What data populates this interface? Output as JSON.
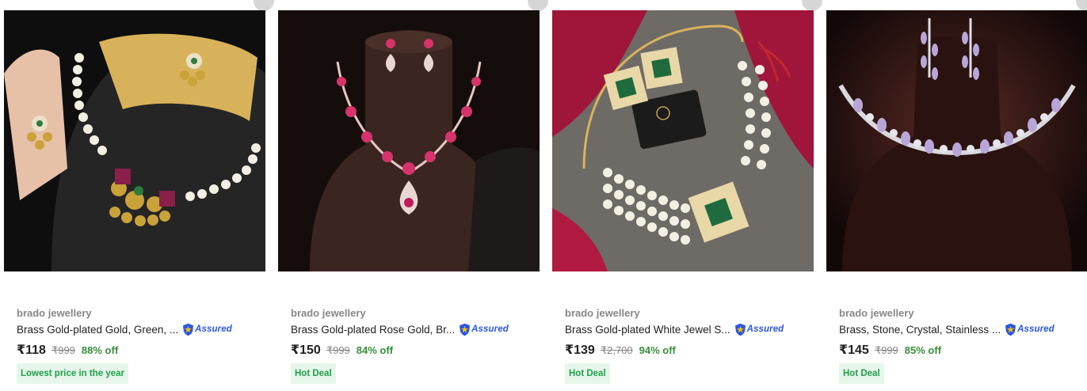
{
  "products": [
    {
      "brand": "brado jewellery",
      "title": "Brass Gold-plated Gold, Green, ...",
      "assured_label": "Assured",
      "price": "₹118",
      "mrp": "₹999",
      "discount": "88% off",
      "badge": "Lowest price in the year",
      "image": "gold-pearl-necklace-set"
    },
    {
      "brand": "brado jewellery",
      "title": "Brass Gold-plated Rose Gold, Br...",
      "assured_label": "Assured",
      "price": "₹150",
      "mrp": "₹999",
      "discount": "84% off",
      "badge": "Hot Deal",
      "image": "rose-gold-pink-stone-necklace-set"
    },
    {
      "brand": "brado jewellery",
      "title": "Brass Gold-plated White Jewel S...",
      "assured_label": "Assured",
      "price": "₹139",
      "mrp": "₹2,700",
      "discount": "94% off",
      "badge": "Hot Deal",
      "image": "pearl-choker-emerald-set"
    },
    {
      "brand": "brado jewellery",
      "title": "Brass, Stone, Crystal, Stainless ...",
      "assured_label": "Assured",
      "price": "₹145",
      "mrp": "₹999",
      "discount": "85% off",
      "badge": "Hot Deal",
      "image": "silver-lavender-crystal-necklace-set"
    }
  ],
  "colors": {
    "discount": "#388e3c",
    "badge_bg": "#e6f6ea",
    "badge_text": "#1f9f4a",
    "assured": "#2a55e5"
  }
}
